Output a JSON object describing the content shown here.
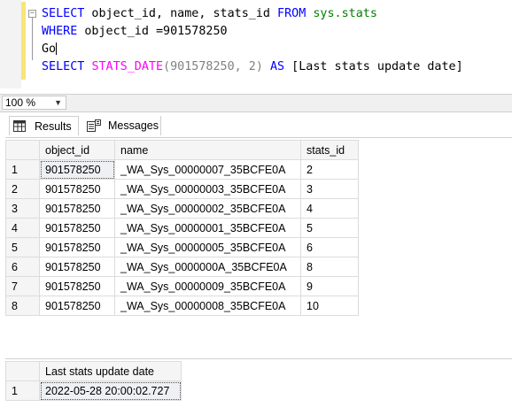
{
  "editor": {
    "line1": {
      "kw1": "SELECT",
      "cols": " object_id, name, stats_id ",
      "kw2": "FROM",
      "sp": " ",
      "obj": "sys.stats"
    },
    "line2": {
      "kw": "WHERE",
      "rest": " object_id =901578250"
    },
    "line3": {
      "text": "Go"
    },
    "line4": {
      "kw1": "SELECT",
      "sp": " ",
      "fn": "STATS_DATE",
      "args": "(901578250, 2) ",
      "kw2": "AS",
      "alias": " [Last stats update date]"
    }
  },
  "zoom": {
    "value": "100 %"
  },
  "tabs": {
    "results": "Results",
    "messages": "Messages"
  },
  "grid1": {
    "headers": {
      "object_id": "object_id",
      "name": "name",
      "stats_id": "stats_id"
    },
    "rows": [
      {
        "n": "1",
        "object_id": "901578250",
        "name": "_WA_Sys_00000007_35BCFE0A",
        "stats_id": "2"
      },
      {
        "n": "2",
        "object_id": "901578250",
        "name": "_WA_Sys_00000003_35BCFE0A",
        "stats_id": "3"
      },
      {
        "n": "3",
        "object_id": "901578250",
        "name": "_WA_Sys_00000002_35BCFE0A",
        "stats_id": "4"
      },
      {
        "n": "4",
        "object_id": "901578250",
        "name": "_WA_Sys_00000001_35BCFE0A",
        "stats_id": "5"
      },
      {
        "n": "5",
        "object_id": "901578250",
        "name": "_WA_Sys_00000005_35BCFE0A",
        "stats_id": "6"
      },
      {
        "n": "6",
        "object_id": "901578250",
        "name": "_WA_Sys_0000000A_35BCFE0A",
        "stats_id": "8"
      },
      {
        "n": "7",
        "object_id": "901578250",
        "name": "_WA_Sys_00000009_35BCFE0A",
        "stats_id": "9"
      },
      {
        "n": "8",
        "object_id": "901578250",
        "name": "_WA_Sys_00000008_35BCFE0A",
        "stats_id": "10"
      }
    ]
  },
  "grid2": {
    "header": "Last stats update date",
    "rows": [
      {
        "n": "1",
        "value": "2022-05-28 20:00:02.727"
      }
    ]
  }
}
